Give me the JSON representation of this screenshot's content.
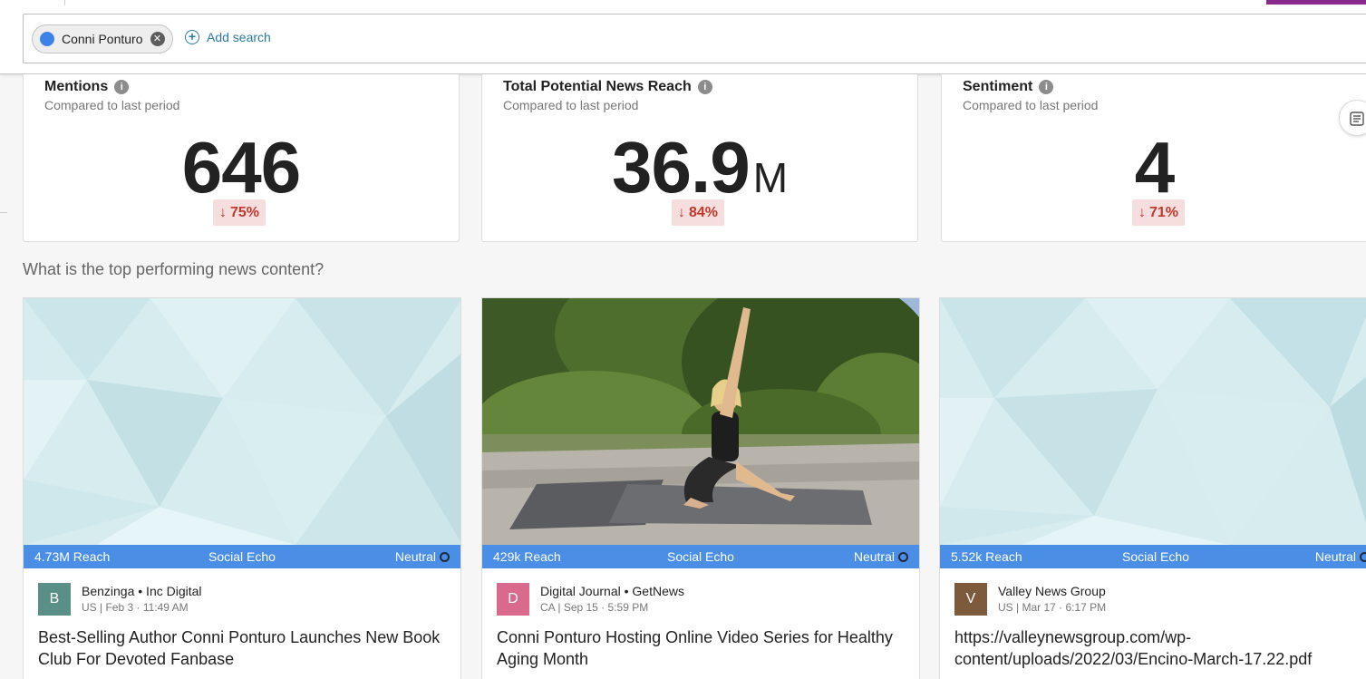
{
  "search": {
    "chip_label": "Conni Ponturo",
    "add_label": "Add search"
  },
  "metrics": [
    {
      "title": "Mentions",
      "subtitle": "Compared to last period",
      "value": "646",
      "unit": "",
      "delta": "75%",
      "direction": "down"
    },
    {
      "title": "Total Potential News Reach",
      "subtitle": "Compared to last period",
      "value": "36.9",
      "unit": "M",
      "delta": "84%",
      "direction": "down"
    },
    {
      "title": "Sentiment",
      "subtitle": "Compared to last period",
      "value": "4",
      "unit": "",
      "delta": "71%",
      "direction": "down"
    }
  ],
  "section_title": "What is the top performing news content?",
  "news": [
    {
      "reach": "4.73M Reach",
      "echo": "Social Echo",
      "sentiment": "Neutral",
      "avatar_letter": "B",
      "avatar_color": "#5a8f88",
      "source": "Benzinga • Inc Digital",
      "country": "US",
      "date": "Feb 3 · 11:49 AM",
      "headline": "Best-Selling Author Conni Ponturo Launches New Book Club For Devoted Fanbase",
      "media": "pattern"
    },
    {
      "reach": "429k Reach",
      "echo": "Social Echo",
      "sentiment": "Neutral",
      "avatar_letter": "D",
      "avatar_color": "#d96a8e",
      "source": "Digital Journal • GetNews",
      "country": "CA",
      "date": "Sep 15 · 5:59 PM",
      "headline": "Conni Ponturo Hosting Online Video Series for Healthy Aging Month",
      "media": "photo"
    },
    {
      "reach": "5.52k Reach",
      "echo": "Social Echo",
      "sentiment": "Neutral",
      "avatar_letter": "V",
      "avatar_color": "#7d5a3c",
      "source": "Valley News Group",
      "country": "US",
      "date": "Mar 17 · 6:17 PM",
      "headline": "https://valleynewsgroup.com/wp-content/uploads/2022/03/Encino-March-17.22.pdf",
      "media": "pattern"
    }
  ],
  "colors": {
    "accent": "#4a8ee6",
    "negative": "#c0392b",
    "negative_bg": "#f7dede",
    "link": "#2c7a9e",
    "brand": "#8a2a8c"
  }
}
